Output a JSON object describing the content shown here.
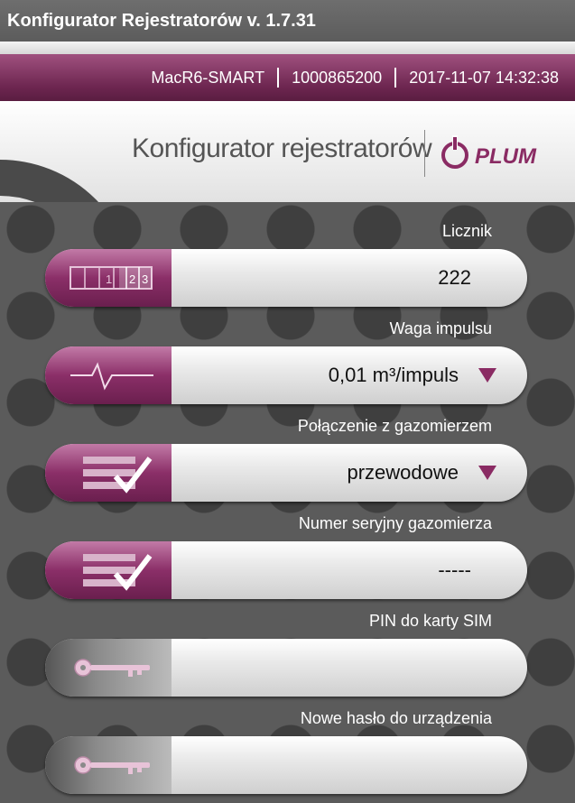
{
  "app": {
    "title": "Konfigurator Rejestratorów v. 1.7.31"
  },
  "status": {
    "device": "MacR6-SMART",
    "serial": "1000865200",
    "datetime": "2017-11-07 14:32:38"
  },
  "header": {
    "brand": "Konfigurator rejestratorów",
    "logo_text": "PLUM"
  },
  "fields": [
    {
      "label": "Licznik",
      "value": "222",
      "icon": "counter-icon",
      "dropdown": false
    },
    {
      "label": "Waga impulsu",
      "value": "0,01 m³/impuls",
      "icon": "pulse-icon",
      "dropdown": true
    },
    {
      "label": "Połączenie z gazomierzem",
      "value": "przewodowe",
      "icon": "checklist-icon",
      "dropdown": true
    },
    {
      "label": "Numer seryjny gazomierza",
      "value": "-----",
      "icon": "checklist-icon",
      "dropdown": false
    },
    {
      "label": "PIN do karty SIM",
      "value": "",
      "icon": "key-icon",
      "dropdown": false
    },
    {
      "label": "Nowe hasło do urządzenia",
      "value": "",
      "icon": "key-icon",
      "dropdown": false
    }
  ],
  "counter_digits": [
    "1",
    "2",
    "3"
  ],
  "colors": {
    "accent": "#8a2b63",
    "title_bar": "#616161"
  }
}
